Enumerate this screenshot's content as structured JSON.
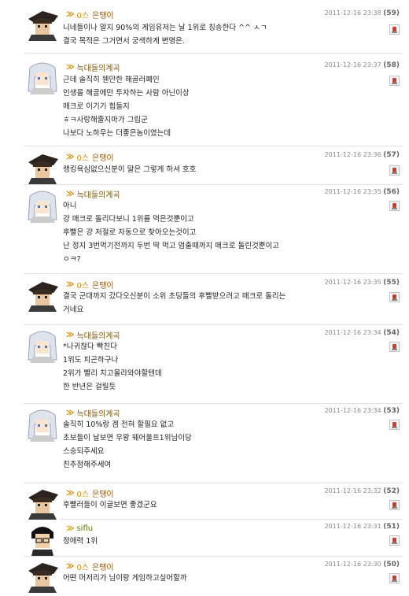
{
  "comments": [
    {
      "nick": "은땡이",
      "lv": "0스",
      "date": "2011-12-16 23:38",
      "count": "(59)",
      "lines": [
        "니네들이나 알지 90%의 게임유저는 날 1위로 칭송한다 ^^ ㅅㄱ",
        "결국 목적은 그거면서 궁색하게 변명은."
      ]
    },
    {
      "nick": "늑대들의계곡",
      "lv": "",
      "date": "2011-12-16 23:37",
      "count": "(58)",
      "lines": [
        "근데 솔직히 웬만한 해골러폐인",
        "인생을 해골에만 투자하는 사람 아닌이상",
        "매크로 이기기 힘들지",
        "ㅎㅋ사랑해줄지마가 그립군",
        "나보다 노하우는 더좋은놈이였는데"
      ]
    },
    {
      "nick": "은땡이",
      "lv": "0스",
      "date": "2011-12-16 23:36",
      "count": "(57)",
      "lines": [
        "랭킹욕심없으신분이 말은 그렇게 하셔 호호"
      ]
    },
    {
      "nick": "늑대들의계곡",
      "lv": "",
      "date": "2011-12-16 23:35",
      "count": "(56)",
      "lines": [
        "아니",
        "걍 매크로 돌리다보니 1위를 먹은것뿐이고",
        "후빨은 걍 저절로 자동으로 찾아오는것이고",
        "난 정지 3번먹기전까지 두번 딱 먹고 멈출때까지 매크로 돌린것뿐이고",
        "ㅇㅋ?"
      ]
    },
    {
      "nick": "은땡이",
      "lv": "0스",
      "date": "2011-12-16 23:35",
      "count": "(55)",
      "lines": [
        "결국 군대까지 갔다오신분이 소위 초딩들의 후빨받으려고 매크로 돌리는",
        "거네요"
      ]
    },
    {
      "nick": "늑대들의계곡",
      "lv": "",
      "date": "2011-12-16 23:34",
      "count": "(54)",
      "lines": [
        "*나귀찮다 빡친다",
        "1위도 피곤하구나",
        "2위가 빨리 치고올라와야할텐데",
        "한 반년은 걸릴듯"
      ]
    },
    {
      "nick": "늑대들의계곡",
      "lv": "",
      "date": "2011-12-16 23:34",
      "count": "(53)",
      "lines": [
        "솔직히 10%랑 겜 전혀 할필요 없고",
        "초보들이 날보면 우왕 웨어울프1위님이당",
        "스승되주세요",
        "친추점해주세여"
      ]
    },
    {
      "nick": "은땡이",
      "lv": "0스",
      "date": "2011-12-16 23:32",
      "count": "(52)",
      "lines": [
        "후빨러들이 이글보면 좋겠군요"
      ]
    },
    {
      "nick": "siflu",
      "lv": "",
      "date": "2011-12-16 23:31",
      "count": "(51)",
      "lines": [
        "정애력 1위"
      ]
    },
    {
      "nick": "은땡이",
      "lv": "0스",
      "date": "2011-12-16 23:30",
      "count": "(50)",
      "lines": [
        "어떤 머저리가 님이랑 게임하고싶어할까"
      ]
    }
  ]
}
